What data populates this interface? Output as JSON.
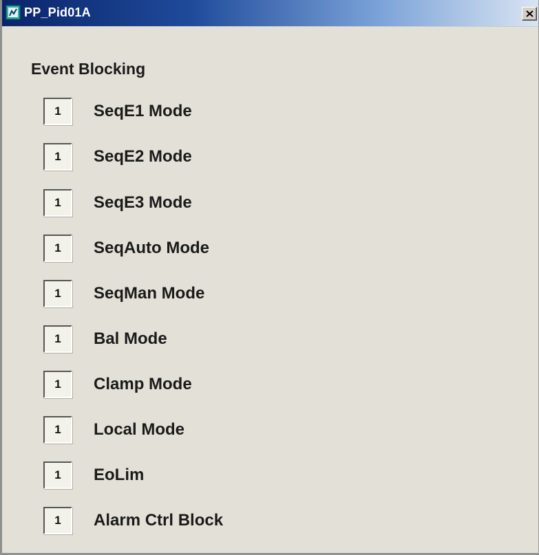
{
  "window": {
    "title": "PP_Pid01A",
    "close_label": "×"
  },
  "section": {
    "title": "Event Blocking"
  },
  "rows": [
    {
      "value": "1",
      "label": "SeqE1 Mode"
    },
    {
      "value": "1",
      "label": "SeqE2 Mode"
    },
    {
      "value": "1",
      "label": "SeqE3 Mode"
    },
    {
      "value": "1",
      "label": "SeqAuto Mode"
    },
    {
      "value": "1",
      "label": "SeqMan Mode"
    },
    {
      "value": "1",
      "label": "Bal Mode"
    },
    {
      "value": "1",
      "label": "Clamp Mode"
    },
    {
      "value": "1",
      "label": "Local Mode"
    },
    {
      "value": "1",
      "label": "EoLim"
    },
    {
      "value": "1",
      "label": "Alarm Ctrl Block"
    }
  ],
  "colors": {
    "titlebar_start": "#0a246a",
    "titlebar_end": "#d9e4f2",
    "panel_background": "#e3e1d7",
    "text": "#1a1a1a"
  },
  "icons": {
    "app_icon": "app-window-icon",
    "close_icon": "close-icon"
  }
}
